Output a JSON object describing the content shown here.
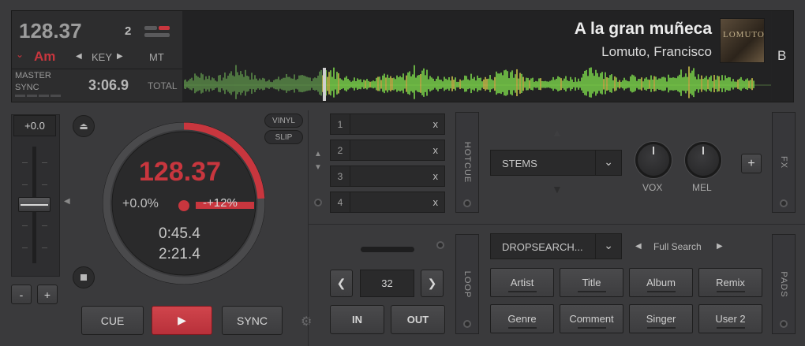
{
  "deck": {
    "letter": "B",
    "bpm": "128.37",
    "deck_number": "2",
    "key": "Am",
    "key_label": "KEY",
    "mt_label": "MT",
    "master_label": "MASTER",
    "sync_label": "SYNC",
    "remaining_time": "3:06.9",
    "total_label": "TOTAL",
    "title": "A la gran muñeca",
    "artist": "Lomuto, Francisco",
    "art_text": "LOMUTO"
  },
  "pitch": {
    "value": "+0.0",
    "minus_label": "-",
    "plus_label": "+",
    "vinyl_label": "VINYL",
    "slip_label": "SLIP"
  },
  "jog": {
    "bpm": "128.37",
    "pitch_percent": "+0.0%",
    "pitch_range": "-+12%",
    "elapsed": "0:45.4",
    "remaining": "2:21.4",
    "progress": 0.24
  },
  "transport": {
    "cue_label": "CUE",
    "play_icon": "▶",
    "sync_label": "SYNC"
  },
  "hotcues": {
    "tab_label": "HOTCUE",
    "clear_label": "x",
    "items": [
      {
        "num": "1"
      },
      {
        "num": "2"
      },
      {
        "num": "3"
      },
      {
        "num": "4"
      }
    ]
  },
  "loop": {
    "tab_label": "LOOP",
    "size": "32",
    "in_label": "IN",
    "out_label": "OUT"
  },
  "stems": {
    "dropdown_label": "STEMS",
    "knobs": [
      "VOX",
      "MEL"
    ],
    "add_label": "+",
    "fx_tab_label": "FX"
  },
  "pads": {
    "tab_label": "PADS",
    "dropdown_label": "DROPSEARCH...",
    "mode_label": "Full Search",
    "tags": [
      "Artist",
      "Title",
      "Album",
      "Remix",
      "Genre",
      "Comment",
      "Singer",
      "User 2"
    ]
  },
  "colors": {
    "accent_red": "#c8363e",
    "waveform_green": "#7bd44a",
    "waveform_played": "#5a8a48"
  }
}
